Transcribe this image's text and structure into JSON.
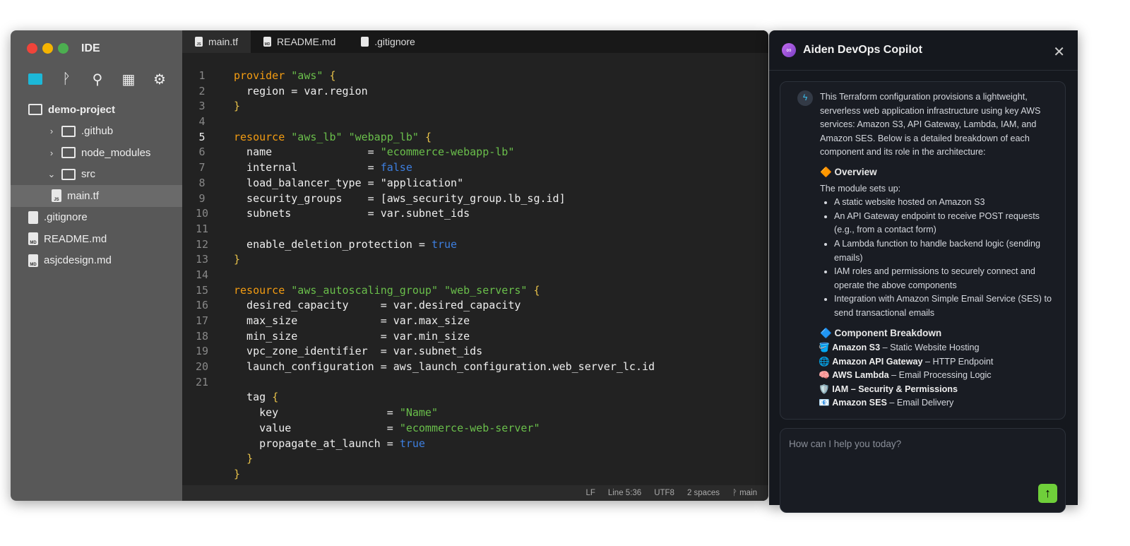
{
  "ide": {
    "title": "IDE",
    "traffic_lights": [
      "#f0443a",
      "#f5b400",
      "#4caf50"
    ],
    "activity_icons": [
      "folder-icon",
      "git-branch-icon",
      "search-icon",
      "extensions-icon",
      "gear-icon"
    ],
    "tree": [
      {
        "label": "demo-project",
        "type": "folder-open",
        "depth": 0,
        "chev": ""
      },
      {
        "label": ".github",
        "type": "folder",
        "depth": 1,
        "chev": "›"
      },
      {
        "label": "node_modules",
        "type": "folder",
        "depth": 1,
        "chev": "›"
      },
      {
        "label": "src",
        "type": "folder-open",
        "depth": 1,
        "chev": "⌄"
      },
      {
        "label": "main.tf",
        "type": "file",
        "badge": "JS",
        "depth": 2,
        "selected": true
      },
      {
        "label": ".gitignore",
        "type": "file",
        "badge": "",
        "depth": 0
      },
      {
        "label": "README.md",
        "type": "file",
        "badge": "MD",
        "depth": 0
      },
      {
        "label": "asjcdesign.md",
        "type": "file",
        "badge": "MD",
        "depth": 0
      }
    ],
    "tabs": [
      {
        "label": "main.tf",
        "badge": "JS",
        "active": true
      },
      {
        "label": "README.md",
        "badge": "MD"
      },
      {
        "label": ".gitignore",
        "badge": ""
      }
    ],
    "current_line": 5,
    "code": [
      [
        [
          "k",
          "provider"
        ],
        [
          "t",
          " "
        ],
        [
          "s",
          "\"aws\""
        ],
        [
          "t",
          " "
        ],
        [
          "p",
          "{"
        ]
      ],
      [
        [
          "t",
          "  region = var.region"
        ]
      ],
      [
        [
          "p",
          "}"
        ]
      ],
      [],
      [
        [
          "k",
          "resource"
        ],
        [
          "t",
          " "
        ],
        [
          "s",
          "\"aws_lb\""
        ],
        [
          "t",
          " "
        ],
        [
          "s",
          "\"webapp_lb\""
        ],
        [
          "t",
          " "
        ],
        [
          "p",
          "{"
        ]
      ],
      [
        [
          "t",
          "  name               = "
        ],
        [
          "s",
          "\"ecommerce-webapp-lb\""
        ]
      ],
      [
        [
          "t",
          "  internal           = "
        ],
        [
          "b",
          "false"
        ]
      ],
      [
        [
          "t",
          "  load_balancer_type = \"application\""
        ]
      ],
      [
        [
          "t",
          "  security_groups    = [aws_security_group.lb_sg.id]"
        ]
      ],
      [
        [
          "t",
          "  subnets            = var.subnet_ids"
        ]
      ],
      [],
      [
        [
          "t",
          "  enable_deletion_protection = "
        ],
        [
          "b",
          "true"
        ]
      ],
      [
        [
          "p",
          "}"
        ]
      ],
      [],
      [
        [
          "k",
          "resource"
        ],
        [
          "t",
          " "
        ],
        [
          "s",
          "\"aws_autoscaling_group\""
        ],
        [
          "t",
          " "
        ],
        [
          "s",
          "\"web_servers\""
        ],
        [
          "t",
          " "
        ],
        [
          "p",
          "{"
        ]
      ],
      [
        [
          "t",
          "  desired_capacity     = var.desired_capacity"
        ]
      ],
      [
        [
          "t",
          "  max_size             = var.max_size"
        ]
      ],
      [
        [
          "t",
          "  min_size             = var.min_size"
        ]
      ],
      [
        [
          "t",
          "  vpc_zone_identifier  = var.subnet_ids"
        ]
      ],
      [
        [
          "t",
          "  launch_configuration = aws_launch_configuration.web_server_lc.id"
        ]
      ],
      [],
      [
        [
          "t",
          "  tag "
        ],
        [
          "p",
          "{"
        ]
      ],
      [
        [
          "t",
          "    key                 = "
        ],
        [
          "s",
          "\"Name\""
        ]
      ],
      [
        [
          "t",
          "    value               = "
        ],
        [
          "s",
          "\"ecommerce-web-server\""
        ]
      ],
      [
        [
          "t",
          "    propagate_at_launch = "
        ],
        [
          "b",
          "true"
        ]
      ],
      [
        [
          "t",
          "  "
        ],
        [
          "p",
          "}"
        ]
      ],
      [
        [
          "p",
          "}"
        ]
      ]
    ],
    "numbered_lines": 21,
    "status": [
      "LF",
      "Line 5:36",
      "UTF8",
      "2 spaces",
      "ᚹ main"
    ]
  },
  "copilot": {
    "title": "Aiden DevOps Copilot",
    "intro": "This Terraform configuration provisions a lightweight, serverless web application infrastructure using key AWS services: Amazon S3, API Gateway, Lambda, IAM, and Amazon SES. Below is a detailed breakdown of each component and its role in the architecture:",
    "overview_heading": "🔶 Overview",
    "overview_lead": "The module sets up:",
    "overview_items": [
      "A static website hosted on Amazon S3",
      "An API Gateway endpoint to receive POST requests (e.g., from a contact form)",
      "A Lambda function to handle backend logic (sending emails)",
      "IAM roles and permissions to securely connect and operate the above components",
      "Integration with Amazon Simple Email Service (SES) to send transactional emails"
    ],
    "breakdown_heading": "🔷 Component Breakdown",
    "components": [
      {
        "emoji": "🪣",
        "name": "Amazon S3",
        "desc": " – Static Website Hosting"
      },
      {
        "emoji": "🌐",
        "name": "Amazon API Gateway",
        "desc": " – HTTP Endpoint"
      },
      {
        "emoji": "🧠",
        "name": "AWS Lambda",
        "desc": " – Email Processing Logic"
      },
      {
        "emoji": "🛡️",
        "name": "IAM – Security & Permissions",
        "desc": ""
      },
      {
        "emoji": "📧",
        "name": "Amazon SES",
        "desc": " – Email Delivery"
      }
    ],
    "input_placeholder": "How can I help you today?",
    "send_color": "#6fcf3a"
  }
}
